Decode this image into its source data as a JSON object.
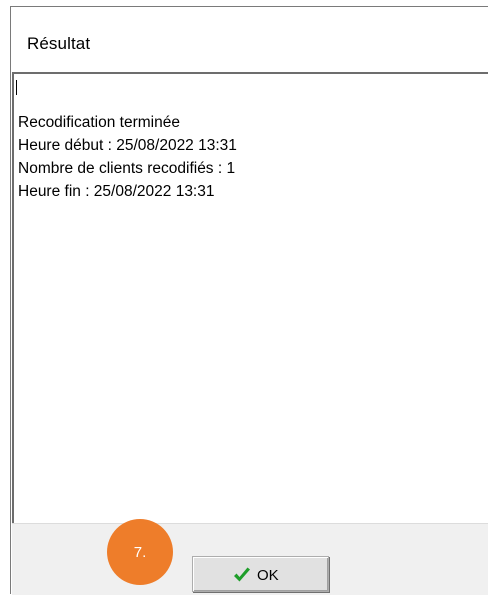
{
  "window": {
    "title": "Résultat"
  },
  "result": {
    "lines": [
      "Recodification terminée",
      "Heure début : 25/08/2022 13:31",
      "Nombre de clients recodifiés : 1",
      "Heure fin : 25/08/2022 13:31"
    ]
  },
  "footer": {
    "ok_label": "OK",
    "ok_icon": "checkmark-icon"
  },
  "annotation": {
    "step_label": "7.",
    "color": "#ee7d2a"
  },
  "colors": {
    "check_green": "#1e9e2a",
    "footer_bg": "#f0f0f0"
  }
}
